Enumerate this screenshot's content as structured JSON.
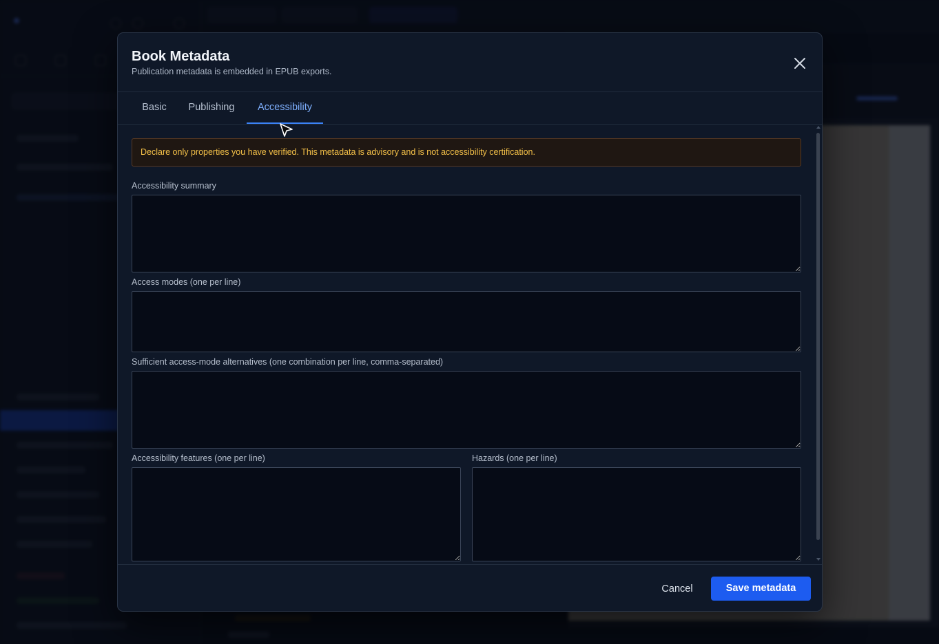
{
  "dialog": {
    "title": "Book Metadata",
    "subtitle": "Publication metadata is embedded in EPUB exports.",
    "close_icon": "close-icon"
  },
  "tabs": [
    {
      "label": "Basic",
      "active": false
    },
    {
      "label": "Publishing",
      "active": false
    },
    {
      "label": "Accessibility",
      "active": true
    }
  ],
  "accessibility": {
    "warning": "Declare only properties you have verified. This metadata is advisory and is not accessibility certification.",
    "summary_label": "Accessibility summary",
    "summary_value": "",
    "access_modes_label": "Access modes (one per line)",
    "access_modes_value": "",
    "sufficient_label": "Sufficient access-mode alternatives (one combination per line, comma-separated)",
    "sufficient_value": "",
    "features_label": "Accessibility features (one per line)",
    "features_value": "",
    "hazards_label": "Hazards (one per line)",
    "hazards_value": ""
  },
  "footer": {
    "cancel_label": "Cancel",
    "save_label": "Save metadata"
  },
  "colors": {
    "accent": "#3b82f6",
    "primary_button": "#1d5cf0",
    "warning_text": "#f4c048",
    "warning_border": "#5a3a22",
    "modal_bg": "#0f1828"
  }
}
